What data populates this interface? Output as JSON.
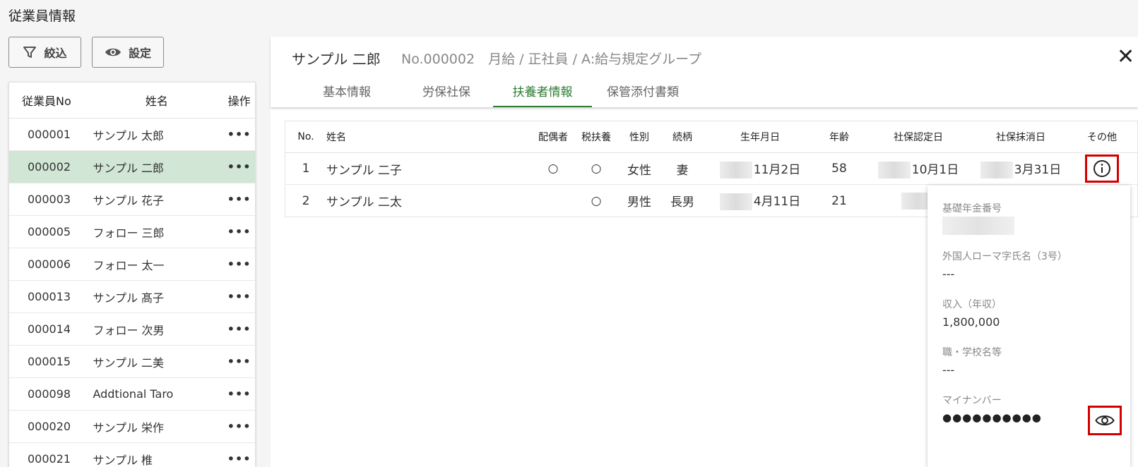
{
  "page_title": "従業員情報",
  "toolbar": {
    "filter_label": "絞込",
    "settings_label": "設定"
  },
  "employee_list": {
    "headers": {
      "no": "従業員No",
      "name": "姓名",
      "action": "操作"
    },
    "rows": [
      {
        "no": "000001",
        "name": "サンプル 太郎",
        "action": "•••"
      },
      {
        "no": "000002",
        "name": "サンプル 二郎",
        "action": "•••",
        "selected": true
      },
      {
        "no": "000003",
        "name": "サンプル 花子",
        "action": "•••"
      },
      {
        "no": "000005",
        "name": "フォロー 三郎",
        "action": "•••"
      },
      {
        "no": "000006",
        "name": "フォロー 太一",
        "action": "•••"
      },
      {
        "no": "000013",
        "name": "サンプル 髙子",
        "action": "•••"
      },
      {
        "no": "000014",
        "name": "フォロー 次男",
        "action": "•••"
      },
      {
        "no": "000015",
        "name": "サンプル 二美",
        "action": "•••"
      },
      {
        "no": "000098",
        "name": "Addtional Taro",
        "action": "•••"
      },
      {
        "no": "000020",
        "name": "サンプル 栄作",
        "action": "•••"
      },
      {
        "no": "000021",
        "name": "サンプル 椎",
        "action": "•••"
      }
    ]
  },
  "detail": {
    "name": "サンプル 二郎",
    "meta": "No.000002　月給 / 正社員 / A:給与規定グループ",
    "close": "✕",
    "tabs": [
      {
        "label": "基本情報"
      },
      {
        "label": "労保社保"
      },
      {
        "label": "扶養者情報",
        "active": true
      },
      {
        "label": "保管添付書類"
      }
    ]
  },
  "dependents": {
    "headers": {
      "no": "No.",
      "name": "姓名",
      "spouse": "配偶者",
      "tax": "税扶養",
      "sex": "性別",
      "relation": "続柄",
      "birth": "生年月日",
      "age": "年齢",
      "insured": "社保認定日",
      "removed": "社保抹消日",
      "other": "その他"
    },
    "rows": [
      {
        "no": "1",
        "name": "サンプル 二子",
        "spouse": "○",
        "tax": "○",
        "sex": "女性",
        "relation": "妻",
        "birth": "11月2日",
        "age": "58",
        "insured": "10月1日",
        "removed": "3月31日"
      },
      {
        "no": "2",
        "name": "サンプル 二太",
        "spouse": "",
        "tax": "○",
        "sex": "男性",
        "relation": "長男",
        "birth": "4月11日",
        "age": "21",
        "insured": "",
        "removed": ""
      }
    ]
  },
  "popup": {
    "pension_label": "基礎年金番号",
    "romaji_label": "外国人ローマ字氏名（3号）",
    "romaji_value": "---",
    "income_label": "収入（年収）",
    "income_value": "1,800,000",
    "job_label": "職・学校名等",
    "job_value": "---",
    "mynumber_label": "マイナンバー",
    "mynumber_value": "●●●●●●●●●●"
  },
  "colors": {
    "accent": "#2e7d32",
    "selected_row": "#d1e6d4",
    "highlight": "#d40000"
  }
}
